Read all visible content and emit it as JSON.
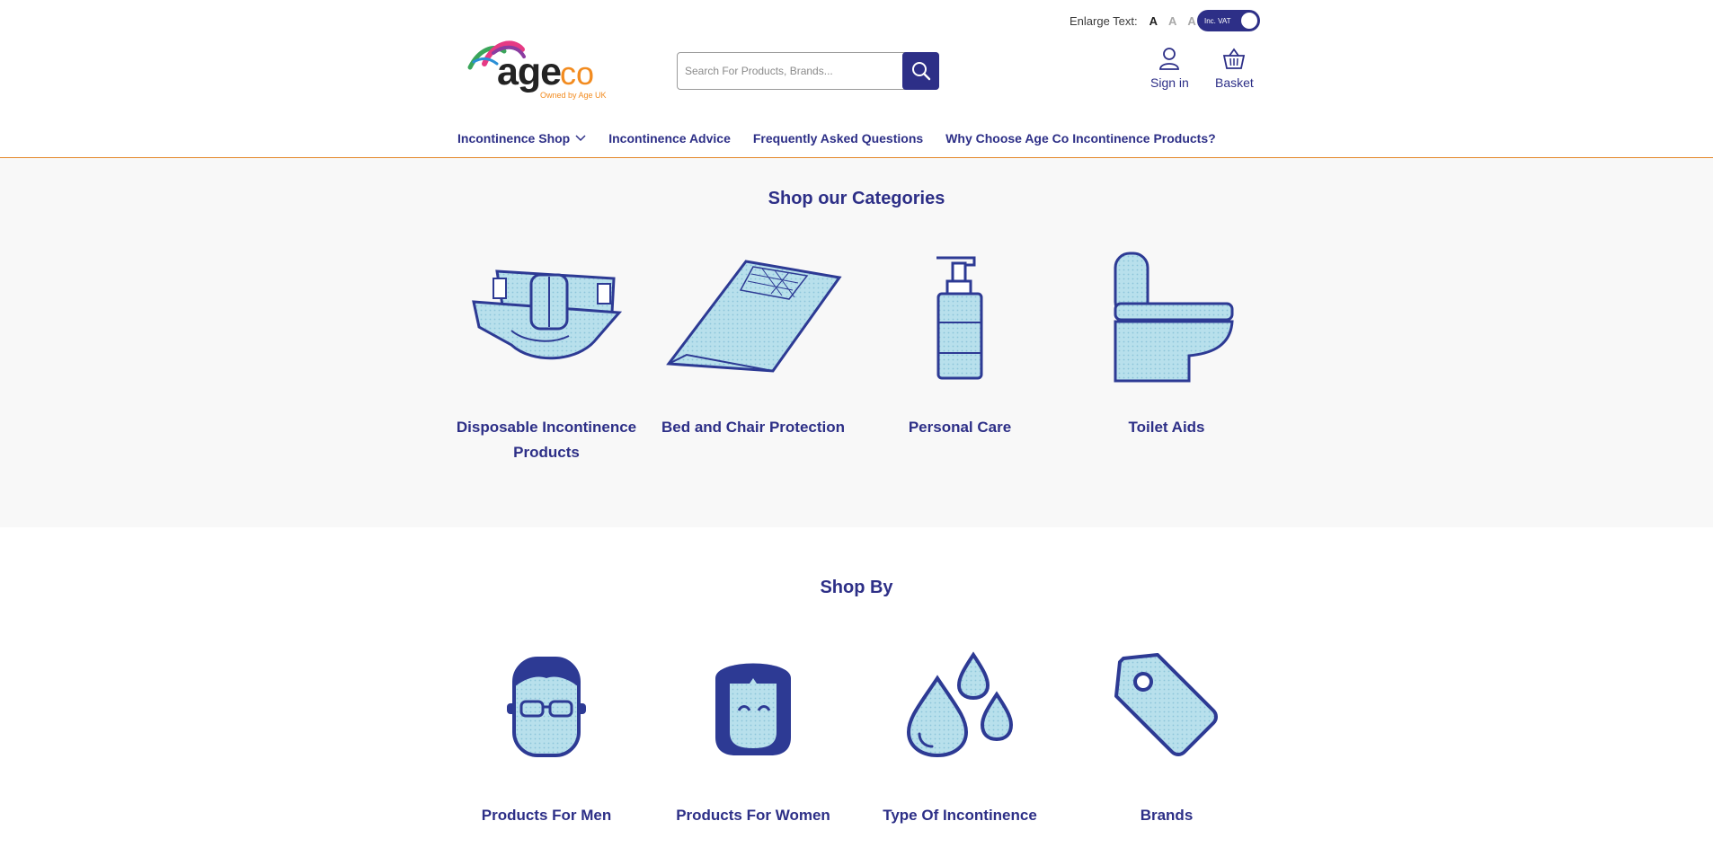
{
  "header": {
    "enlarge_label": "Enlarge Text:",
    "size_a_small": "A",
    "size_a_medium": "A",
    "size_a_large": "A",
    "vat_toggle_label": "Inc. VAT",
    "logo_word": "age",
    "logo_co": "co",
    "logo_tagline": "Owned by Age UK",
    "search_placeholder": "Search For Products, Brands...",
    "sign_in": "Sign in",
    "basket": "Basket"
  },
  "nav": {
    "items": [
      {
        "label": "Incontinence Shop"
      },
      {
        "label": "Incontinence Advice"
      },
      {
        "label": "Frequently Asked Questions"
      },
      {
        "label": "Why Choose Age Co Incontinence Products?"
      }
    ]
  },
  "categories": {
    "title": "Shop our Categories",
    "items": [
      {
        "label": "Disposable Incontinence Products",
        "icon": "nappy-icon"
      },
      {
        "label": "Bed and Chair Protection",
        "icon": "bed-pad-icon"
      },
      {
        "label": "Personal Care",
        "icon": "soap-dispenser-icon"
      },
      {
        "label": "Toilet Aids",
        "icon": "toilet-icon"
      }
    ]
  },
  "shop_by": {
    "title": "Shop By",
    "items": [
      {
        "label": "Products For Men",
        "icon": "man-face-icon"
      },
      {
        "label": "Products For Women",
        "icon": "woman-face-icon"
      },
      {
        "label": "Type Of Incontinence",
        "icon": "droplets-icon"
      },
      {
        "label": "Brands",
        "icon": "price-tag-icon"
      }
    ]
  },
  "colors": {
    "brand_navy": "#2d2f87",
    "accent_orange": "#f28b1f",
    "icon_fill": "#a8d8e8",
    "section_bg": "#f8f8f8"
  }
}
